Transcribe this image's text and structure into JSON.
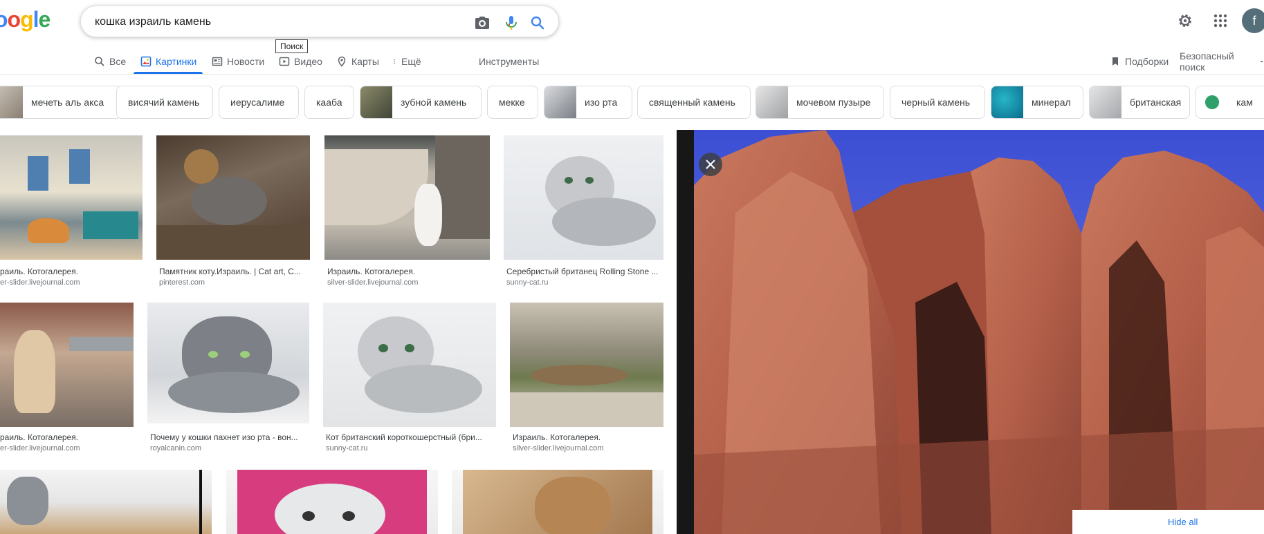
{
  "logo": {
    "text": "oogle"
  },
  "search": {
    "query": "кошка израиль камень",
    "tooltip": "Поиск"
  },
  "header": {
    "avatar_letter": "f"
  },
  "tabs": [
    {
      "label": "Все"
    },
    {
      "label": "Картинки"
    },
    {
      "label": "Новости"
    },
    {
      "label": "Видео"
    },
    {
      "label": "Карты"
    },
    {
      "label": "Ещё"
    },
    {
      "label": "Инструменты"
    }
  ],
  "tools_right": {
    "collections": "Подборки",
    "safesearch": "Безопасный поиск"
  },
  "chips": [
    {
      "label": "мечеть аль акса"
    },
    {
      "label": "висячий камень"
    },
    {
      "label": "иерусалиме"
    },
    {
      "label": "кааба"
    },
    {
      "label": "зубной камень"
    },
    {
      "label": "мекке"
    },
    {
      "label": "изо рта"
    },
    {
      "label": "священный камень"
    },
    {
      "label": "мочевом пузыре"
    },
    {
      "label": "черный камень"
    },
    {
      "label": "минерал"
    },
    {
      "label": "британская"
    },
    {
      "label": "кам"
    }
  ],
  "results": [
    {
      "title": "раиль. Котогалерея.",
      "source": "er-slider.livejournal.com"
    },
    {
      "title": "Памятник коту.Израиль. | Cat art, C...",
      "source": "pinterest.com"
    },
    {
      "title": "Израиль. Котогалерея.",
      "source": "silver-slider.livejournal.com"
    },
    {
      "title": "Серебристый британец Rolling Stone ...",
      "source": "sunny-cat.ru"
    },
    {
      "title": "раиль. Котогалерея.",
      "source": "er-slider.livejournal.com"
    },
    {
      "title": "Почему у кошки пахнет изо рта - вон...",
      "source": "royalcanin.com"
    },
    {
      "title": "Кот британский короткошерстный (бри...",
      "source": "sunny-cat.ru"
    },
    {
      "title": "Израиль. Котогалерея.",
      "source": "silver-slider.livejournal.com"
    }
  ],
  "preview": {
    "hide_all": "Hide all"
  },
  "colors": {
    "accent": "#1a73e8",
    "chip_border": "#dadce0",
    "panel_bg": "#171717"
  }
}
